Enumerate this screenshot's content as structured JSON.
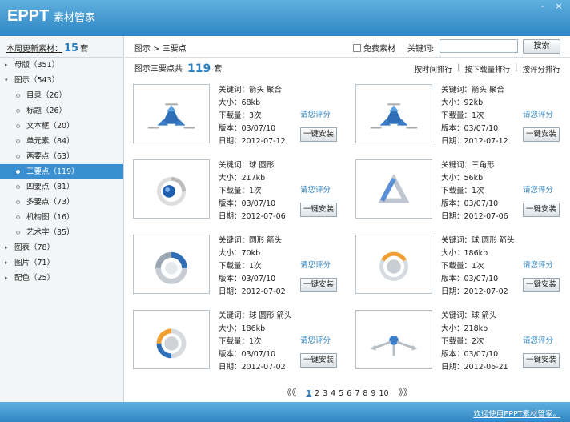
{
  "app": {
    "title_main": "EPPT",
    "title_sub": "素材管家"
  },
  "window": {
    "minimize": "-",
    "close": "×"
  },
  "sidebar": {
    "header_label": "本周更新素材：",
    "header_count": "15",
    "header_unit": "套",
    "items": [
      {
        "label": "母版（351）",
        "level": 0,
        "tri": "▸"
      },
      {
        "label": "图示（543）",
        "level": 0,
        "tri": "▾"
      },
      {
        "label": "目录（26）",
        "level": 1
      },
      {
        "label": "标题（26）",
        "level": 1
      },
      {
        "label": "文本框（20）",
        "level": 1
      },
      {
        "label": "单元素（84）",
        "level": 1
      },
      {
        "label": "两要点（63）",
        "level": 1
      },
      {
        "label": "三要点（119）",
        "level": 1,
        "selected": true
      },
      {
        "label": "四要点（81）",
        "level": 1
      },
      {
        "label": "多要点（73）",
        "level": 1
      },
      {
        "label": "机构图（16）",
        "level": 1
      },
      {
        "label": "艺术字（35）",
        "level": 1
      },
      {
        "label": "图表（78）",
        "level": 0,
        "tri": "▸"
      },
      {
        "label": "图片（71）",
        "level": 0,
        "tri": "▸"
      },
      {
        "label": "配色（25）",
        "level": 0,
        "tri": "▸"
      }
    ]
  },
  "topbar": {
    "breadcrumb": "图示 > 三要点",
    "free_label": "免费素材",
    "keyword_label": "关键词:",
    "keyword_value": "",
    "search_button": "搜索"
  },
  "summary": {
    "prefix": "图示三要点共",
    "count": "119",
    "unit": "套"
  },
  "sorts": {
    "by_time": "按时间排行",
    "by_downloads": "按下载量排行",
    "by_rating": "按评分排行",
    "sep": "|"
  },
  "labels": {
    "rate": "请您评分",
    "install": "一键安装"
  },
  "items": [
    {
      "keywords": "关键词：箭头 聚合",
      "size": "大小：68kb",
      "downloads": "下载量：3次",
      "version": "版本：03/07/10",
      "date": "日期：2012-07-12",
      "thumb": "triangle-diagram"
    },
    {
      "keywords": "关键词：箭头 聚合",
      "size": "大小：92kb",
      "downloads": "下载量：1次",
      "version": "版本：03/07/10",
      "date": "日期：2012-07-12",
      "thumb": "triangle-diagram"
    },
    {
      "keywords": "关键词：球 圆形",
      "size": "大小：217kb",
      "downloads": "下载量：1次",
      "version": "版本：03/07/10",
      "date": "日期：2012-07-06",
      "thumb": "sphere-ring"
    },
    {
      "keywords": "关键词：三角形",
      "size": "大小：56kb",
      "downloads": "下载量：1次",
      "version": "版本：03/07/10",
      "date": "日期：2012-07-06",
      "thumb": "triangle-outline"
    },
    {
      "keywords": "关键词：圆形 箭头",
      "size": "大小：70kb",
      "downloads": "下载量：1次",
      "version": "版本：03/07/10",
      "date": "日期：2012-07-02",
      "thumb": "circle-arrows"
    },
    {
      "keywords": "关键词：球 圆形 箭头",
      "size": "大小：186kb",
      "downloads": "下载量：1次",
      "version": "版本：03/07/10",
      "date": "日期：2012-07-02",
      "thumb": "sphere-orange"
    },
    {
      "keywords": "关键词：球 圆形 箭头",
      "size": "大小：186kb",
      "downloads": "下载量：1次",
      "version": "版本：03/07/10",
      "date": "日期：2012-07-02",
      "thumb": "sphere-ring-color"
    },
    {
      "keywords": "关键词：球 箭头",
      "size": "大小：218kb",
      "downloads": "下载量：2次",
      "version": "版本：03/07/10",
      "date": "日期：2012-06-21",
      "thumb": "ball-arrows"
    }
  ],
  "pager": {
    "prev": "《《",
    "next": "》》",
    "pages": [
      "1",
      "2",
      "3",
      "4",
      "5",
      "6",
      "7",
      "8",
      "9",
      "10"
    ],
    "current": "1"
  },
  "footer": {
    "welcome": "欢迎使用EPPT素材管家。"
  },
  "colors": {
    "accent": "#2f86c4",
    "selected": "#3a8fd0"
  }
}
